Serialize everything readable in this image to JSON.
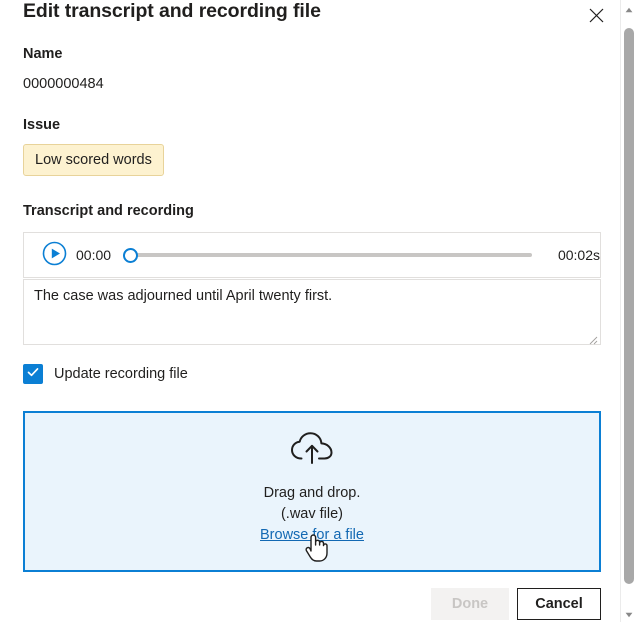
{
  "dialog": {
    "title": "Edit transcript and recording file",
    "close_icon": "close-icon"
  },
  "name_section": {
    "label": "Name",
    "value": "0000000484"
  },
  "issue_section": {
    "label": "Issue",
    "badge": "Low scored words",
    "badge_bg": "#fdf2d0",
    "badge_border": "#e8d39a"
  },
  "transcript_section": {
    "label": "Transcript and recording",
    "player": {
      "play_icon": "play-icon",
      "current_time": "00:00",
      "total_time": "00:02s",
      "progress_percent": 0,
      "accent": "#0b7fd4"
    },
    "textarea": {
      "value": "The case was adjourned until April twenty first.",
      "placeholder": ""
    }
  },
  "update_recording": {
    "label": "Update recording file",
    "checked": true,
    "accent": "#0b7fd4"
  },
  "dropzone": {
    "icon": "cloud-upload-icon",
    "line1": "Drag and drop.",
    "line2": "(.wav file)",
    "link": "Browse for a file",
    "background": "#eaf4fc",
    "border_color": "#0b7fd4"
  },
  "footer": {
    "done_label": "Done",
    "done_disabled": true,
    "cancel_label": "Cancel"
  },
  "scrollbar": {
    "up_icon": "chevron-up-icon",
    "down_icon": "chevron-down-icon"
  }
}
